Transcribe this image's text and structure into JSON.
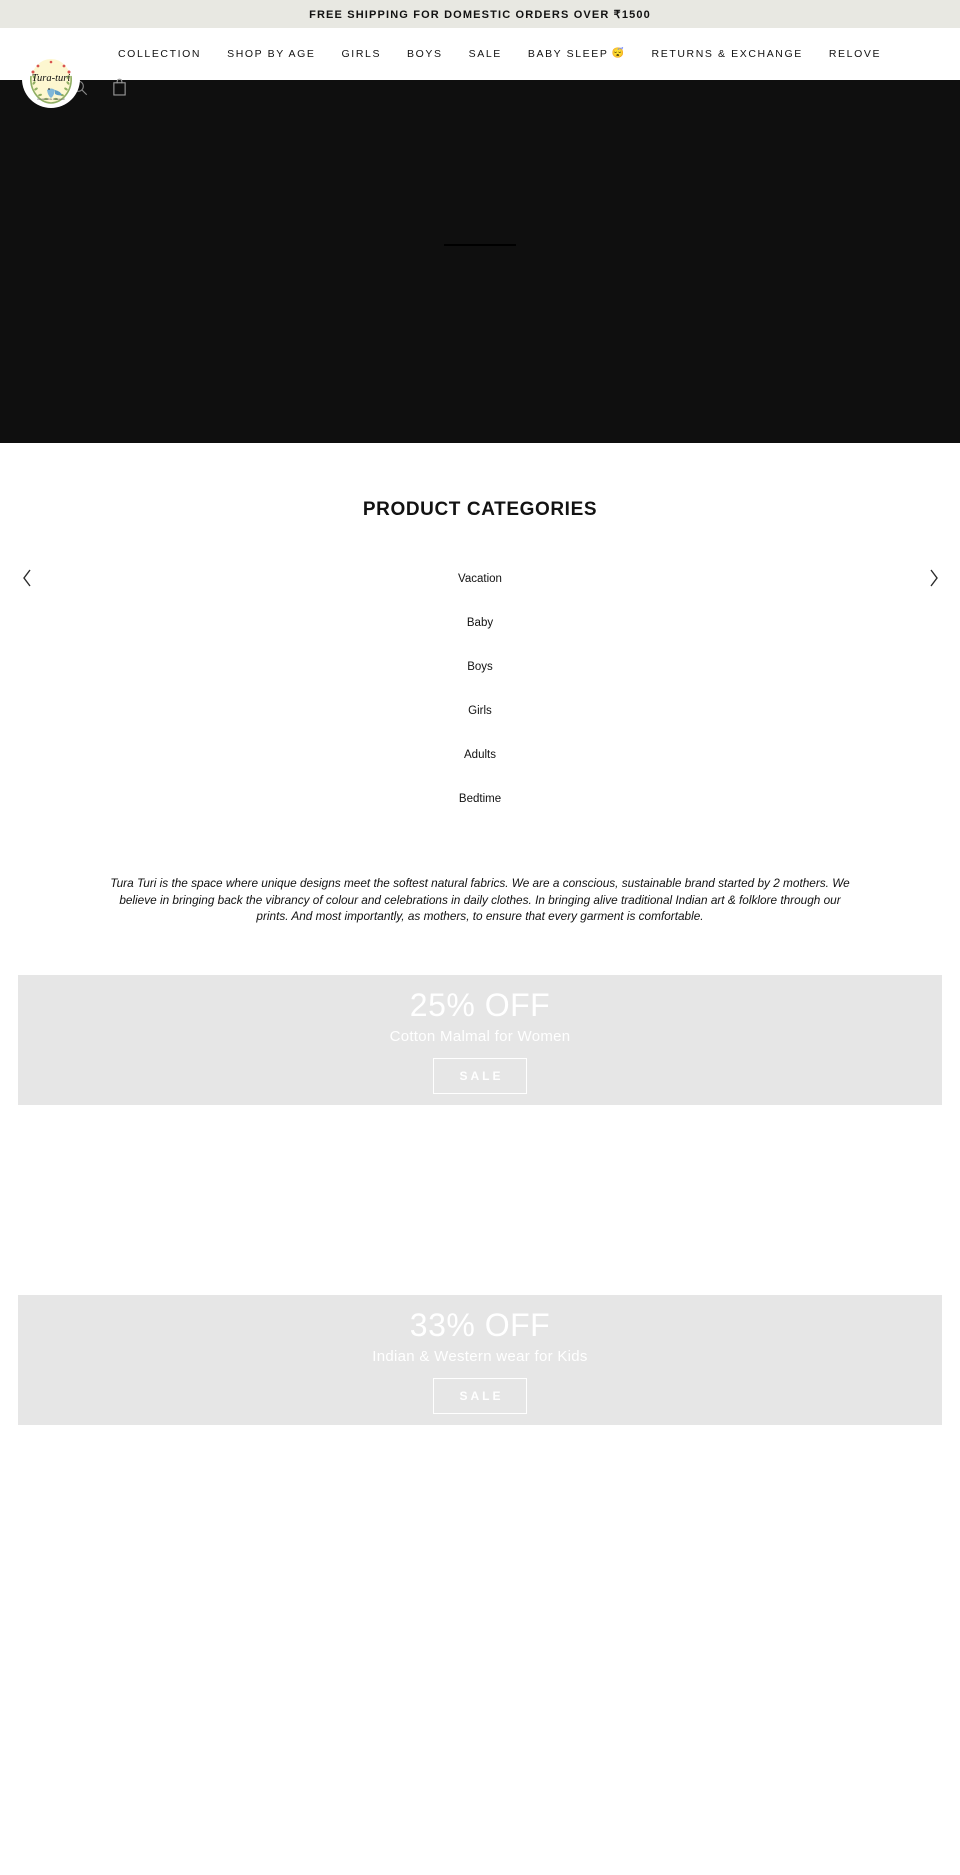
{
  "announcement": {
    "text": "FREE SHIPPING FOR DOMESTIC ORDERS OVER ₹1500"
  },
  "header": {
    "logo_name": "Tura Turi",
    "logo_alt": "Tura Turi laurel wreath bird logo",
    "nav": [
      {
        "label": "COLLECTION"
      },
      {
        "label": "SHOP BY AGE"
      },
      {
        "label": "GIRLS"
      },
      {
        "label": "BOYS"
      },
      {
        "label": "SALE"
      },
      {
        "label": "BABY SLEEP",
        "emoji": "😴"
      },
      {
        "label": "RETURNS & EXCHANGE"
      },
      {
        "label": "RELOVE"
      }
    ],
    "icons": {
      "search": "search-icon",
      "cart": "cart-icon"
    }
  },
  "hero": {
    "background_color": "#0f0f0f"
  },
  "categories": {
    "title": "PRODUCT CATEGORIES",
    "prev_label": "‹",
    "next_label": "›",
    "items": [
      {
        "label": "Vacation"
      },
      {
        "label": "Baby"
      },
      {
        "label": "Boys"
      },
      {
        "label": "Girls"
      },
      {
        "label": "Adults"
      },
      {
        "label": "Bedtime"
      }
    ]
  },
  "about": {
    "text": "Tura Turi is the space where unique designs meet the softest natural fabrics. We are a conscious, sustainable brand started by 2 mothers. We believe in bringing back the vibrancy of colour and celebrations in daily clothes. In bringing alive traditional Indian art & folklore through our prints. And most importantly, as mothers, to ensure that every garment is comfortable."
  },
  "promos": [
    {
      "headline": "25% OFF",
      "subtitle": "Cotton Malmal for Women",
      "button": "SALE"
    },
    {
      "headline": "33% OFF",
      "subtitle": "Indian & Western wear for Kids",
      "button": "SALE"
    }
  ],
  "colors": {
    "announcement_bg": "#e8e8e2",
    "hero_bg": "#0f0f0f",
    "promo_bg": "#e6e6e6",
    "text": "#121212"
  }
}
